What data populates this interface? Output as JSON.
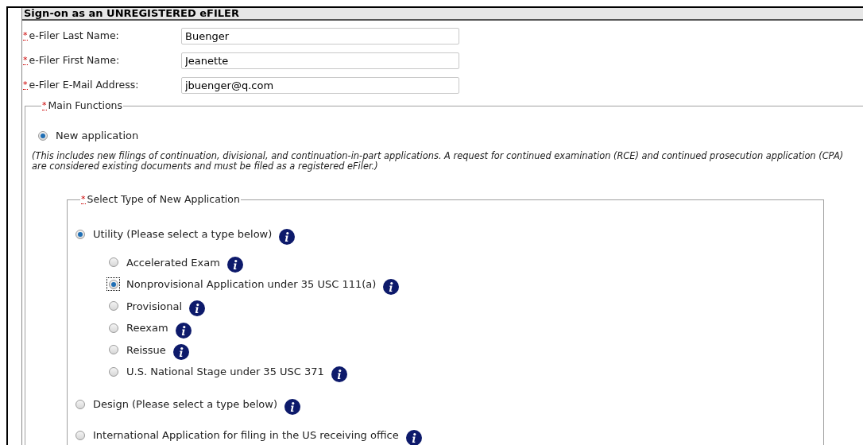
{
  "title": "Sign-on as an UNREGISTERED eFILER",
  "fields": [
    {
      "required_mark": "*",
      "label": "e-Filer Last Name:",
      "value": "Buenger"
    },
    {
      "required_mark": "*",
      "label": "e-Filer First Name:",
      "value": "Jeanette"
    },
    {
      "required_mark": "*",
      "label": "e-Filer E-Mail Address:",
      "value": "jbuenger@q.com"
    }
  ],
  "main_functions": {
    "required_mark": "*",
    "legend": "Main Functions",
    "options": [
      {
        "label": "New application",
        "selected": true
      }
    ],
    "note": "(This includes new filings of continuation, divisional, and continuation-in-part applications. A request for continued examination (RCE) and continued prosecution application (CPA) are considered existing documents and must be filed as a registered eFiler.)",
    "new_application_type": {
      "required_mark": "*",
      "legend": "Select Type of New Application",
      "options": [
        {
          "label": "Utility (Please select a type below)",
          "selected": true,
          "info": true,
          "children": [
            {
              "label": "Accelerated Exam",
              "selected": false,
              "focused": false,
              "info": true
            },
            {
              "label": "Nonprovisional Application under 35 USC 111(a)",
              "selected": true,
              "focused": true,
              "info": true
            },
            {
              "label": "Provisional",
              "selected": false,
              "focused": false,
              "info": true
            },
            {
              "label": "Reexam",
              "selected": false,
              "focused": false,
              "info": true
            },
            {
              "label": "Reissue",
              "selected": false,
              "focused": false,
              "info": true
            },
            {
              "label": "U.S. National Stage under 35 USC 371",
              "selected": false,
              "focused": false,
              "info": true
            }
          ]
        },
        {
          "label": "Design (Please select a type below)",
          "selected": false,
          "info": true
        },
        {
          "label": "International Application for filing in the US receiving office",
          "selected": false,
          "info": true
        }
      ]
    }
  }
}
